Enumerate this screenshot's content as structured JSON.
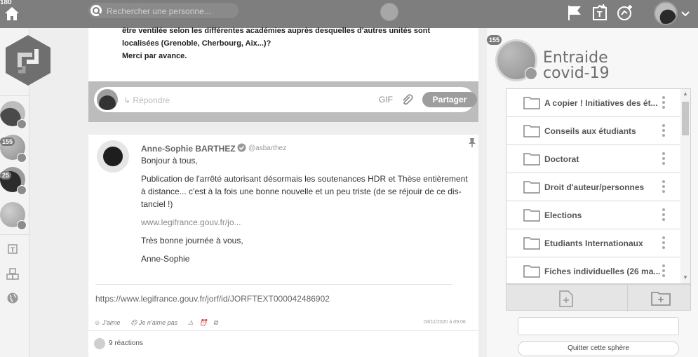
{
  "topbar": {
    "home_badge": "180",
    "search_placeholder": "Rechercher une personne...",
    "icons": [
      "home-icon",
      "search-logo-icon",
      "globe-icon",
      "flag-icon",
      "add-tag-icon",
      "add-sphere-icon",
      "avatar",
      "chevron-down-icon"
    ]
  },
  "rail": {
    "badges": [
      "155",
      "25"
    ],
    "icons": [
      "tag-icon",
      "boxes-icon",
      "globe-icon"
    ]
  },
  "feed": {
    "previous_post_lines": [
      "être ventilée selon les différentes académies auprès desquelles d'autres unités sont",
      "localisées (Grenoble, Cherbourg, Aix...)?",
      "Merci par avance."
    ],
    "reply_placeholder": "↳ Répondre",
    "gif_label": "GIF",
    "share_label": "Partager",
    "post": {
      "author": "Anne-Sophie BARTHEZ",
      "handle": "@asbarthez",
      "greeting": "Bonjour à tous,",
      "body": "Publication de l'arrêté autorisant désormais les soutenances HDR et Thèse entièrement à distance... c'est à la fois une bonne nouvelle et un peu triste (de se réjouir de ce dis-tanciel !)",
      "short_link": "www.legifrance.gouv.fr/jo...",
      "closing": "Très bonne journée à vous,",
      "signature": "Anne-Sophie",
      "preview_url": "https://www.legifrance.gouv.fr/jorf/id/JORFTEXT000042486902",
      "like_label": "J'aime",
      "dislike_label": "Je n'aime pas",
      "date": "03/11/2020 à 09:06",
      "reactions": "9 réactions"
    }
  },
  "sphere": {
    "badge": "155",
    "title_line1": "Entraide",
    "title_line2": "covid-19",
    "folders": [
      "A copier ! Initiatives des ét...",
      "Conseils aux étudiants",
      "Doctorat",
      "Droit d'auteur/personnes",
      "Elections",
      "Etudiants Internationaux",
      "Fiches individuelles (26 ma..."
    ],
    "quit_label": "Quitter cette sphère"
  }
}
